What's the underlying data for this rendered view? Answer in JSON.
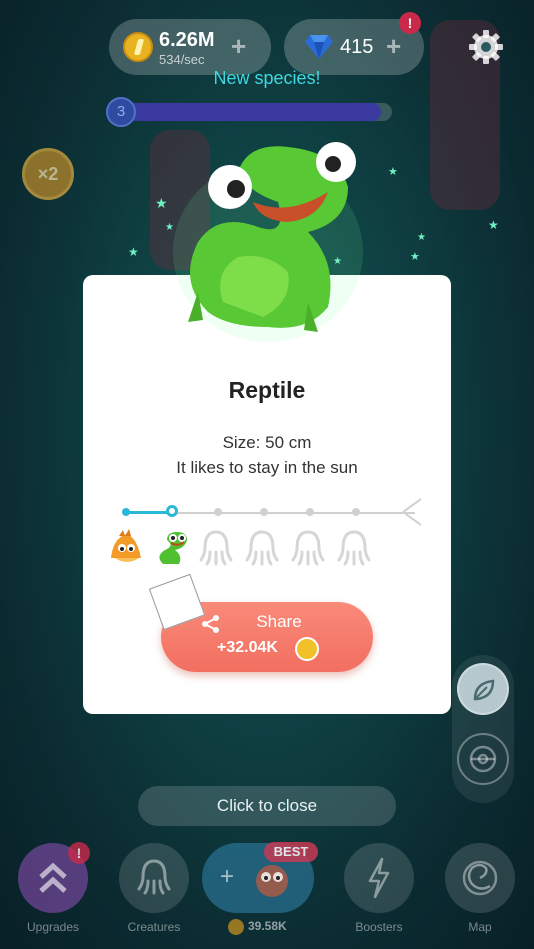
{
  "topbar": {
    "coins_value": "6.26M",
    "coins_rate": "534/sec",
    "gems_value": "415",
    "gems_badge": "!"
  },
  "new_species_label": "New species!",
  "progress": {
    "level": "3",
    "fill_fraction": 0.96
  },
  "multiplier_label": "×2",
  "card": {
    "title": "Reptile",
    "size_text": "Size: 50 cm",
    "description": "It likes to stay in the sun",
    "evolution_current_step": 2,
    "evolution_total_steps": 7
  },
  "share": {
    "label": "Share",
    "reward": "+32.04K"
  },
  "close_label": "Click to close",
  "bottom_nav": {
    "upgrades": "Upgrades",
    "upgrades_badge": "!",
    "creatures": "Creatures",
    "best_badge": "BEST",
    "center_cost": "39.58K",
    "boosters": "Boosters",
    "map": "Map"
  },
  "colors": {
    "accent": "#2ab8d8",
    "share_button": "#f47a6a",
    "title_text": "#222222",
    "new_species": "#3fd7e0"
  },
  "icons": [
    "coin-icon",
    "gem-icon",
    "gear-icon",
    "share-icon",
    "leaf-icon",
    "pokeball-icon",
    "upgrade-chevrons-icon",
    "octopus-icon",
    "lightning-icon",
    "spiral-map-icon"
  ]
}
